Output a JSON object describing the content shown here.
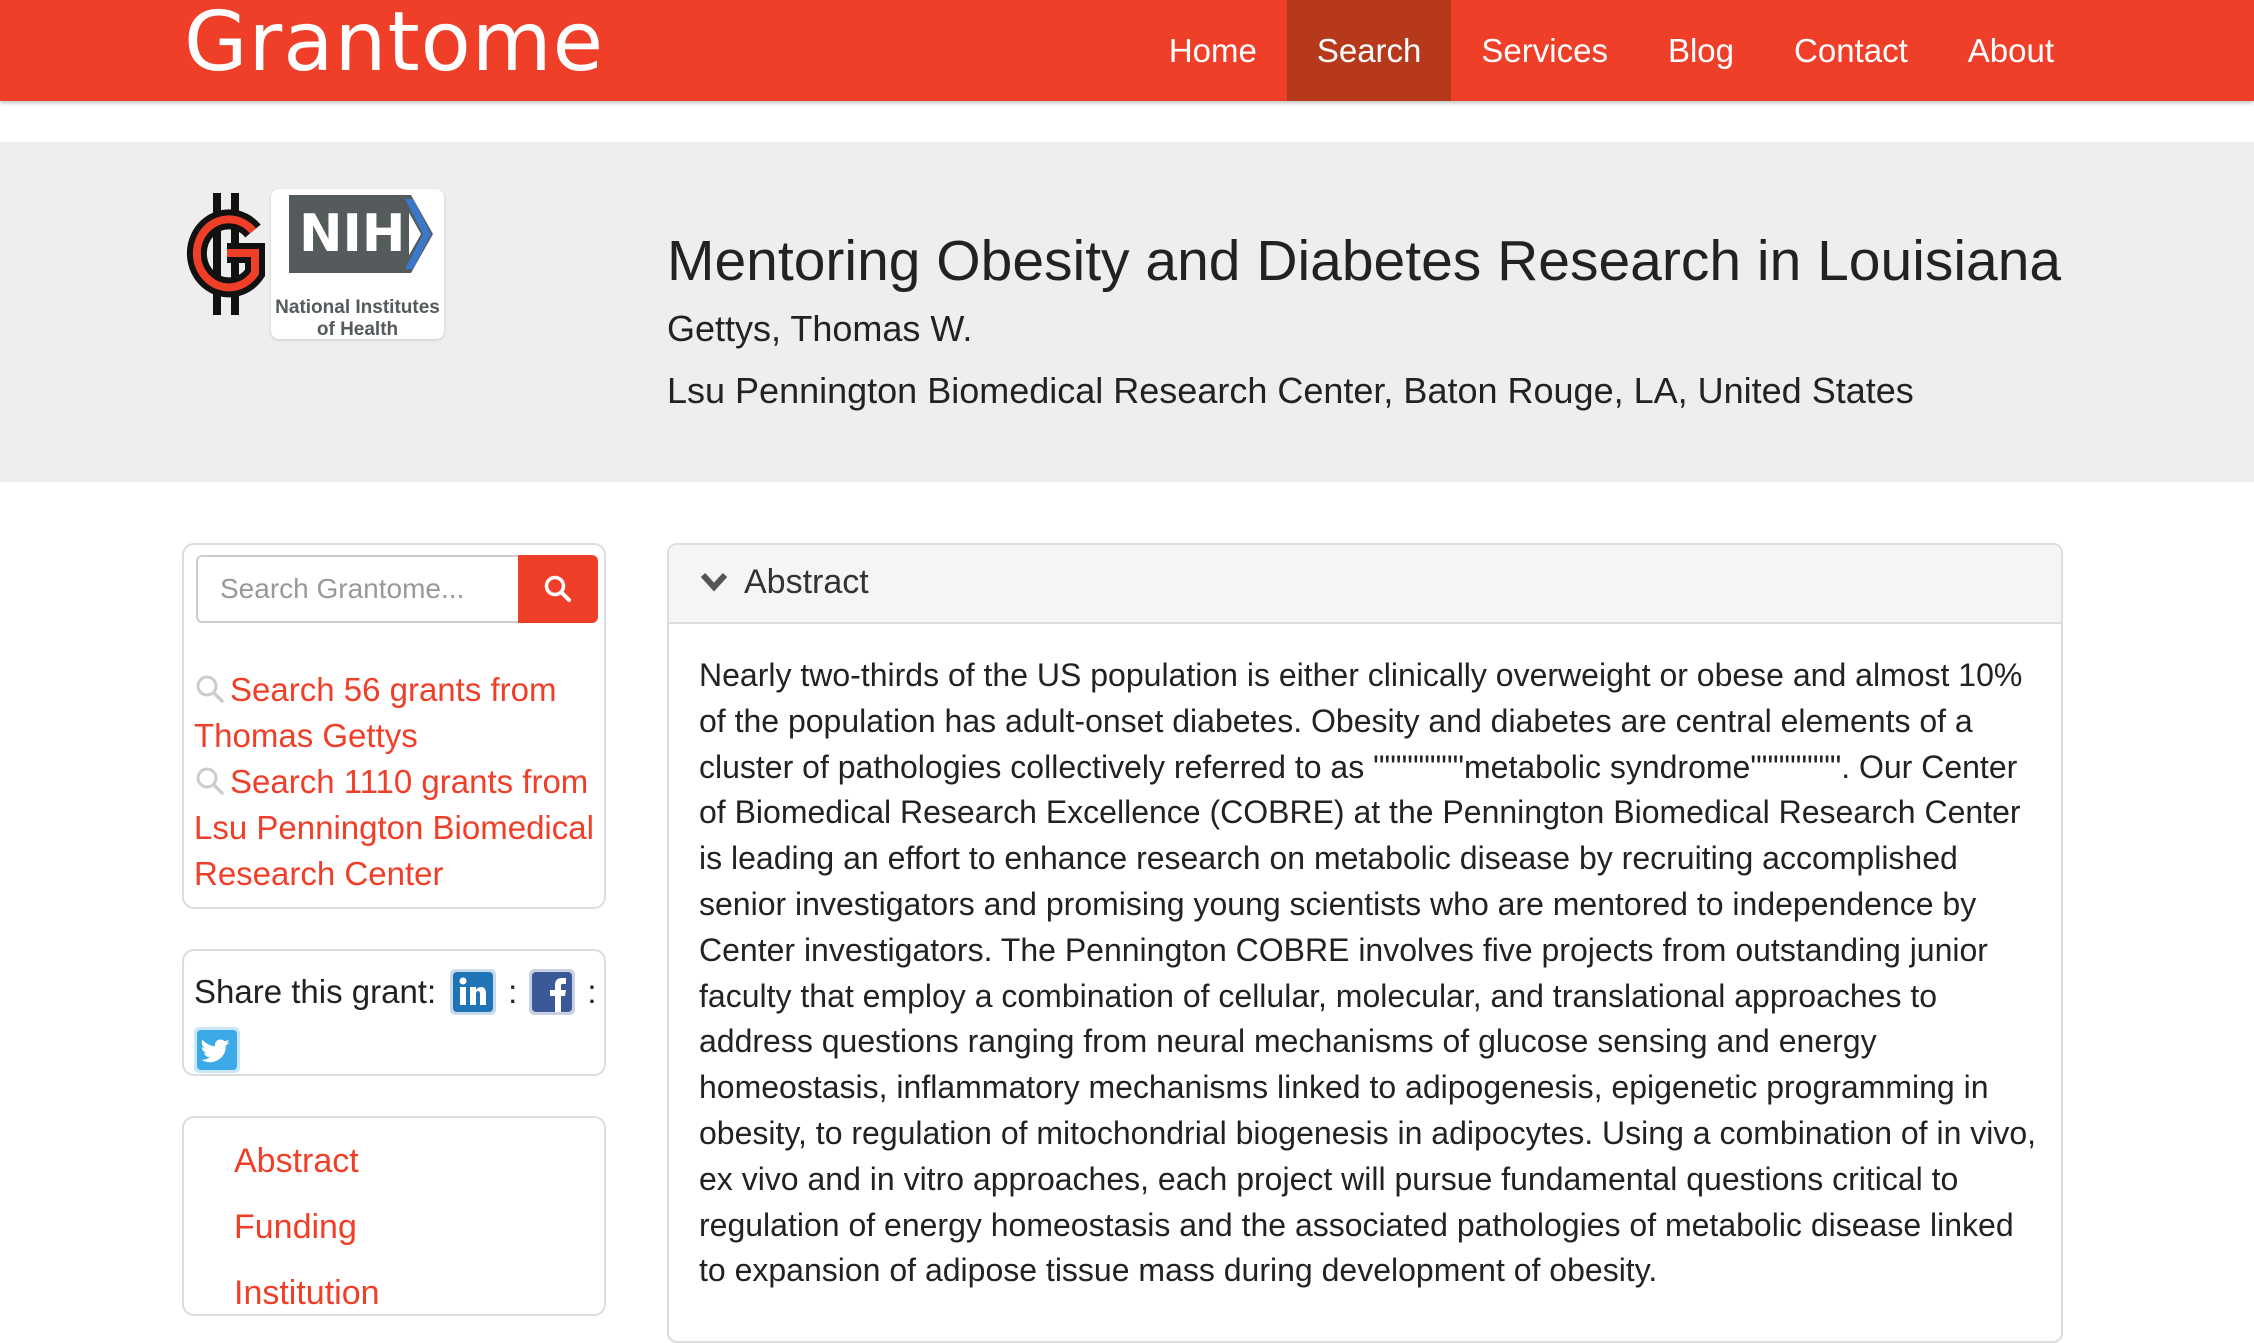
{
  "brand": {
    "name": "Grantome"
  },
  "nav": {
    "items": [
      {
        "label": "Home",
        "active": false
      },
      {
        "label": "Search",
        "active": true
      },
      {
        "label": "Services",
        "active": false
      },
      {
        "label": "Blog",
        "active": false
      },
      {
        "label": "Contact",
        "active": false
      },
      {
        "label": "About",
        "active": false
      }
    ]
  },
  "funder": {
    "abbr": "NIH",
    "name_line1": "National Institutes",
    "name_line2": "of Health"
  },
  "grant": {
    "title": "Mentoring Obesity and Diabetes Research in Louisiana",
    "pi": "Gettys, Thomas W.",
    "institution": "Lsu Pennington Biomedical Research Center, Baton Rouge, LA, United States"
  },
  "sidebar": {
    "search_placeholder": "Search Grantome...",
    "related": [
      {
        "text": "Search 56 grants from Thomas Gettys"
      },
      {
        "text": "Search 1110 grants from Lsu Pennington Biomedical Research Center"
      }
    ],
    "share_label": "Share this grant:",
    "sep": ":",
    "sections": [
      "Abstract",
      "Funding",
      "Institution"
    ]
  },
  "abstract": {
    "heading": "Abstract",
    "text": "Nearly two-thirds of the US population is either clinically overweight or obese and almost 10% of the population has adult-onset diabetes. Obesity and diabetes are central elements of a cluster of pathologies collectively referred to as \"\"\"\"\"\"\"\"metabolic syndrome\"\"\"\"\"\"\"\". Our Center of Biomedical Research Excellence (COBRE) at the Pennington Biomedical Research Center is leading an effort to enhance research on metabolic disease by recruiting accomplished senior investigators and promising young scientists who are mentored to independence by Center investigators. The Pennington COBRE involves five projects from outstanding junior faculty that employ a combination of cellular, molecular, and translational approaches to address questions ranging from neural mechanisms of glucose sensing and energy homeostasis, inflammatory mechanisms linked to adipogenesis, epigenetic programming in obesity, to regulation of mitochondrial biogenesis in adipocytes. Using a combination of in vivo, ex vivo and in vitro approaches, each project will pursue fundamental questions critical to regulation of energy homeostasis and the associated pathologies of metabolic disease linked to expansion of adipose tissue mass during development of obesity."
  },
  "colors": {
    "brand": "#ef3f29",
    "nav_active": "#b5391a",
    "band": "#eeeeee",
    "linkedin": "#1f73b7",
    "facebook": "#3b5998",
    "twitter": "#3ba9e8"
  },
  "icons": [
    "search-icon",
    "magnifier-icon",
    "linkedin-icon",
    "facebook-icon",
    "twitter-icon",
    "chevron-down-icon"
  ]
}
